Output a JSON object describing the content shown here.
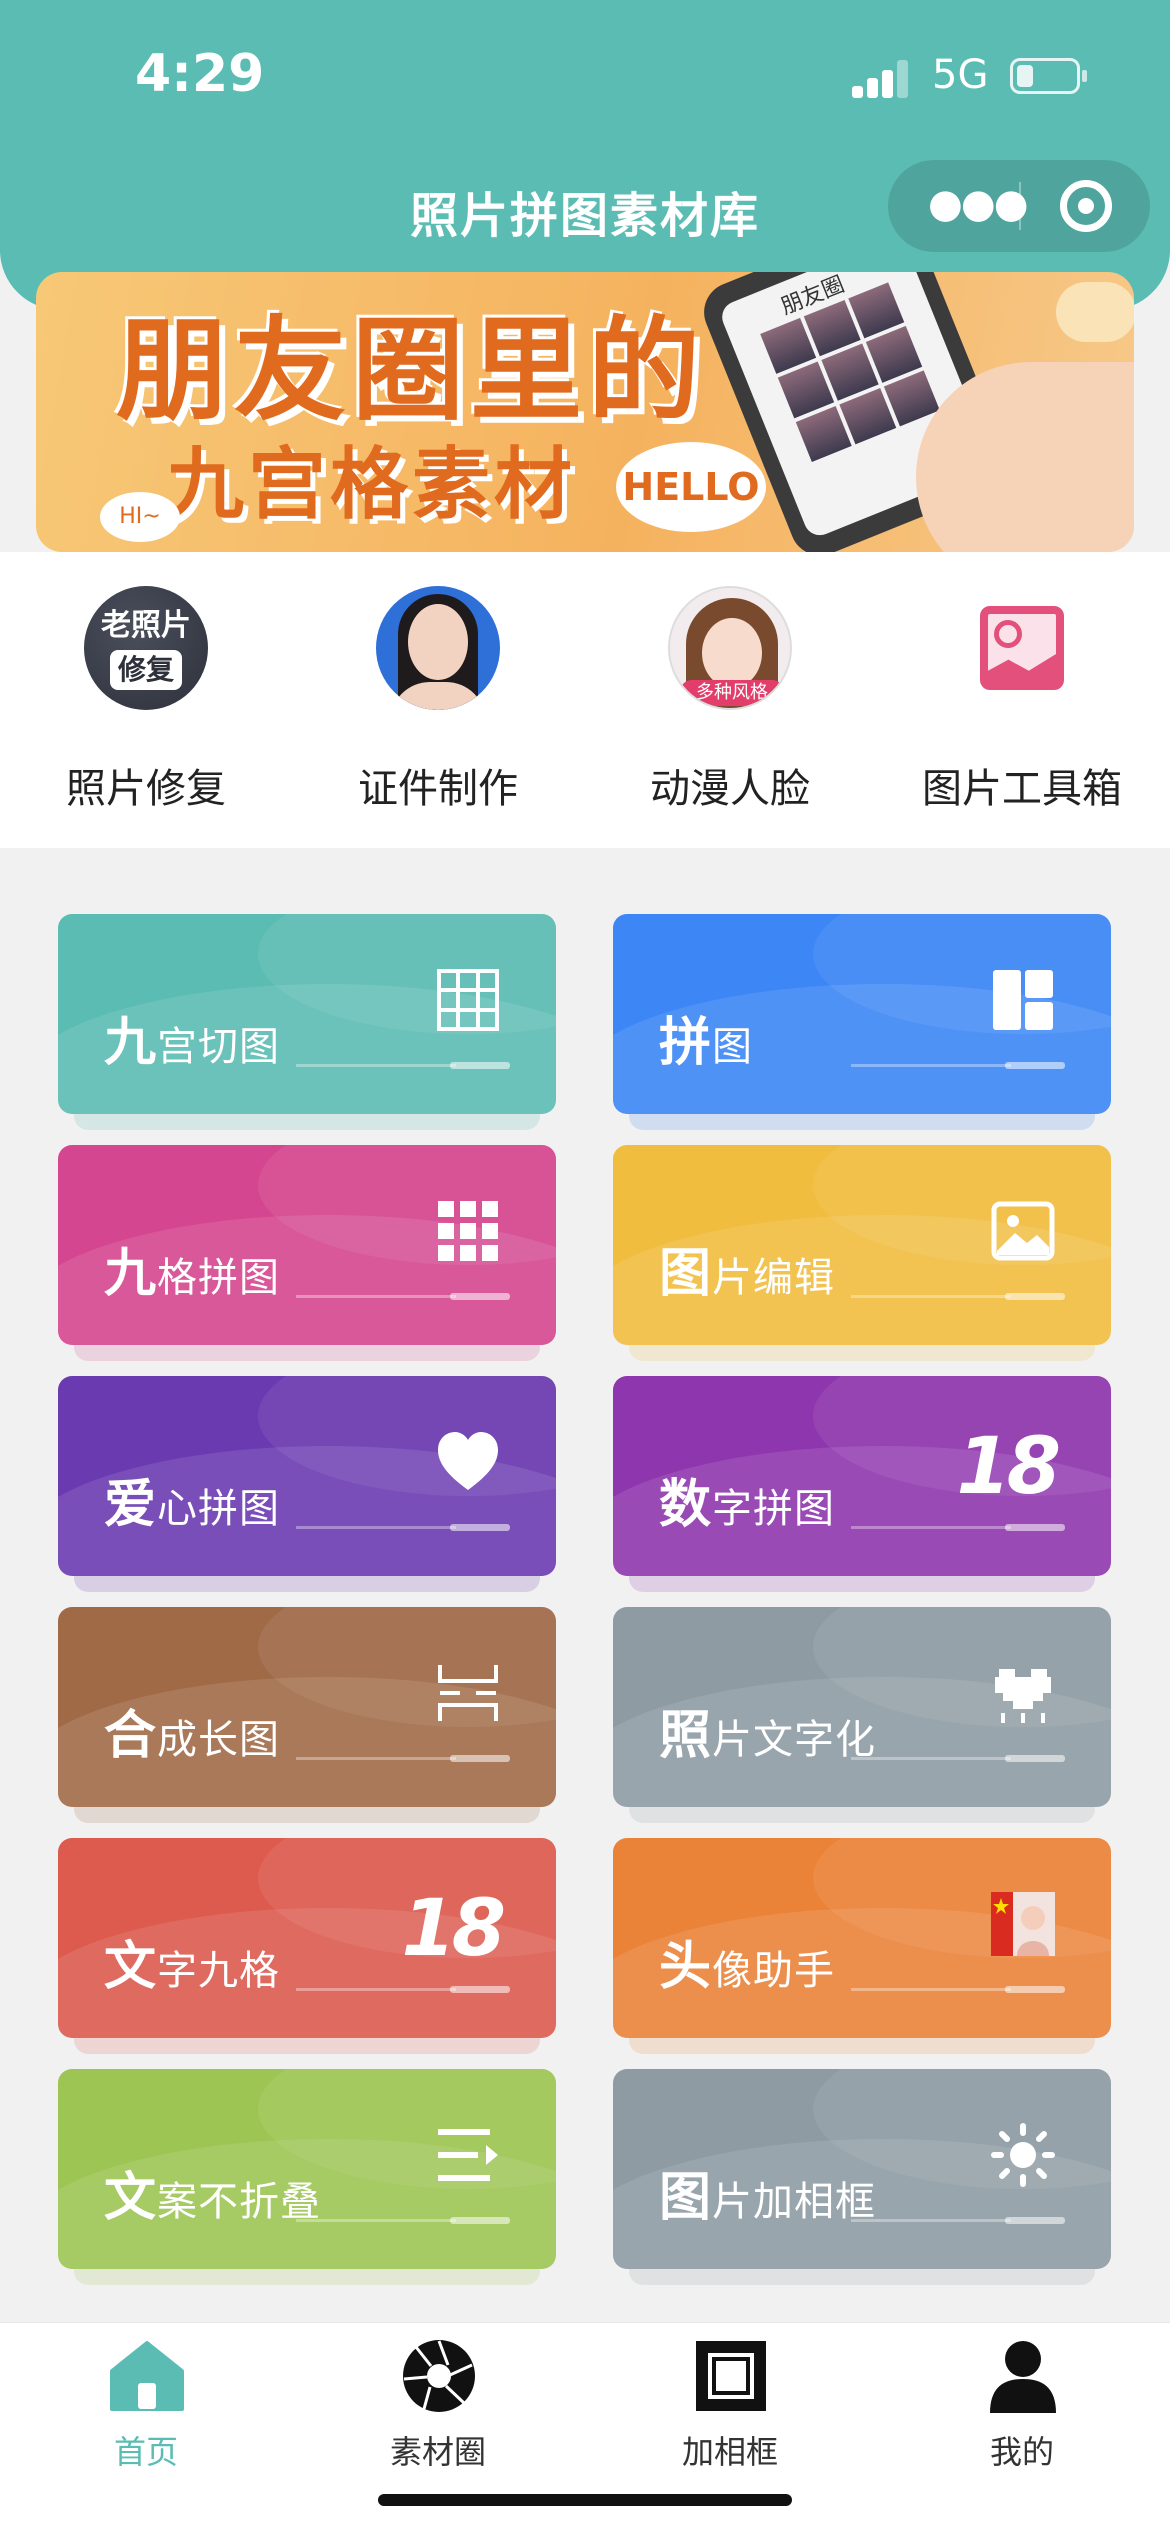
{
  "status_bar": {
    "time": "4:29",
    "network": "5G"
  },
  "header": {
    "title": "照片拼图素材库",
    "menu_icon": "more-dots-icon",
    "close_icon": "target-icon"
  },
  "banner": {
    "line1": "朋友圈里的",
    "line2": "九宫格素材",
    "hello": "HELLO",
    "hi": "HI~",
    "phone_label": "朋友圈"
  },
  "quick": [
    {
      "label": "照片修复",
      "icon": "old-photo-restore-icon",
      "badge_1": "老照片",
      "badge_2": "修复"
    },
    {
      "label": "证件制作",
      "icon": "id-photo-icon"
    },
    {
      "label": "动漫人脸",
      "icon": "anime-face-icon",
      "tag": "多种风格"
    },
    {
      "label": "图片工具箱",
      "icon": "picture-toolbox-icon"
    }
  ],
  "tools": [
    {
      "lead": "九",
      "rest": "宫切图",
      "icon": "grid-icon",
      "color": "#5bbcb3"
    },
    {
      "lead": "拼",
      "rest": "图",
      "icon": "layout-icon",
      "color": "#3c86f5"
    },
    {
      "lead": "九",
      "rest": "格拼图",
      "icon": "dots-grid-icon",
      "color": "#d4468f"
    },
    {
      "lead": "图",
      "rest": "片编辑",
      "icon": "image-icon",
      "color": "#f1bd3e"
    },
    {
      "lead": "爱",
      "rest": "心拼图",
      "icon": "heart-icon",
      "color": "#6a3ab0"
    },
    {
      "lead": "数",
      "rest": "字拼图",
      "icon_text": "18",
      "color": "#8e36ad"
    },
    {
      "lead": "合",
      "rest": "成长图",
      "icon": "merge-icon",
      "color": "#a06a47"
    },
    {
      "lead": "照",
      "rest": "片文字化",
      "icon": "pixel-heart-icon",
      "color": "#8e9ba3"
    },
    {
      "lead": "文",
      "rest": "字九格",
      "icon_text": "18",
      "color": "#dc5b4e"
    },
    {
      "lead": "头",
      "rest": "像助手",
      "icon": "avatar-flag-icon",
      "color": "#ea8338"
    },
    {
      "lead": "文",
      "rest": "案不折叠",
      "icon": "text-expand-icon",
      "color": "#9cc553"
    },
    {
      "lead": "图",
      "rest": "片加相框",
      "icon": "sun-icon",
      "color": "#8e9ba3"
    }
  ],
  "tabbar": [
    {
      "label": "首页",
      "icon": "home-icon",
      "active": true
    },
    {
      "label": "素材圈",
      "icon": "aperture-icon",
      "active": false
    },
    {
      "label": "加相框",
      "icon": "stamp-frame-icon",
      "active": false
    },
    {
      "label": "我的",
      "icon": "user-icon",
      "active": false
    }
  ]
}
